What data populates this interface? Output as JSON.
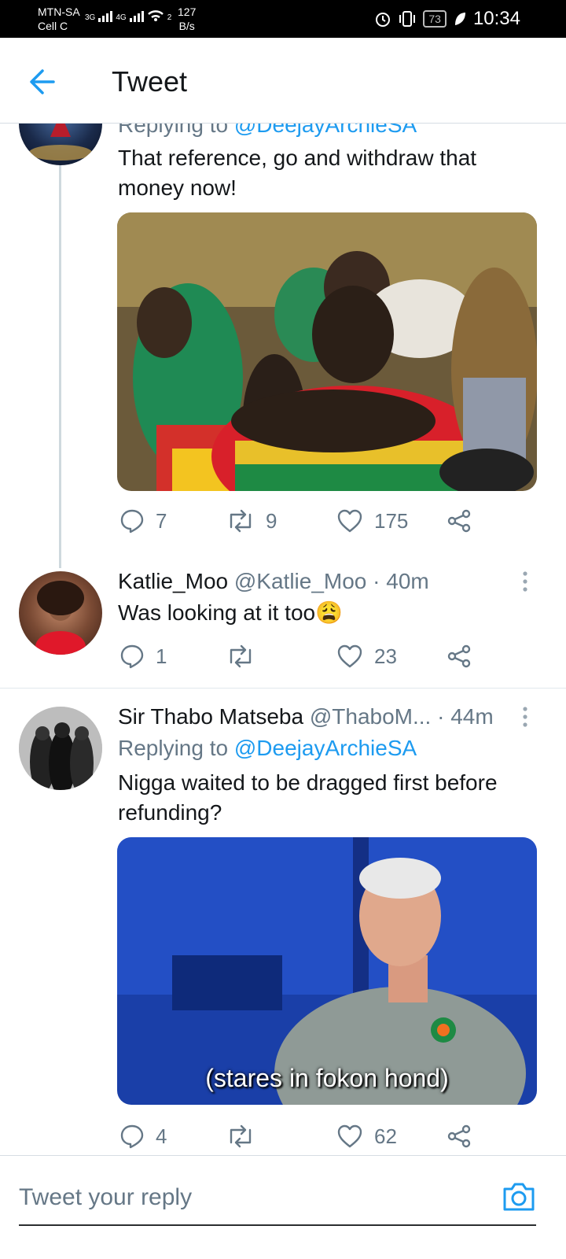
{
  "status_bar": {
    "carrier_1": "MTN-SA",
    "carrier_2": "Cell C",
    "network_1": "3G",
    "network_2": "4G",
    "wifi_number": "2",
    "speed_value": "127",
    "speed_unit": "B/s",
    "battery": "73",
    "time": "10:34"
  },
  "header": {
    "title": "Tweet"
  },
  "tweets": [
    {
      "replying_label": "Replying to",
      "replying_handle": "@DeejayArchieSA",
      "text_line_1": "That reference, go and withdraw that",
      "text_line_2": "money now!",
      "replies": "7",
      "retweets": "9",
      "likes": "175"
    },
    {
      "name": "Katlie_Moo",
      "meta": "@Katlie_Moo · 40m",
      "text": "Was looking at it too",
      "emoji": "😩",
      "replies": "1",
      "retweets": "",
      "likes": "23"
    },
    {
      "name": "Sir Thabo Matseba",
      "meta": "@ThaboM... · 44m",
      "replying_label": "Replying to",
      "replying_handle": "@DeejayArchieSA",
      "text_line_1": "Nigga waited to be dragged first before",
      "text_line_2": "refunding?",
      "media_caption": "(stares in fokon hond)",
      "replies": "4",
      "retweets": "",
      "likes": "62"
    }
  ],
  "reply_bar": {
    "placeholder": "Tweet your reply"
  },
  "colors": {
    "accent": "#1d9bf0",
    "muted": "#657786",
    "text": "#14171a"
  }
}
